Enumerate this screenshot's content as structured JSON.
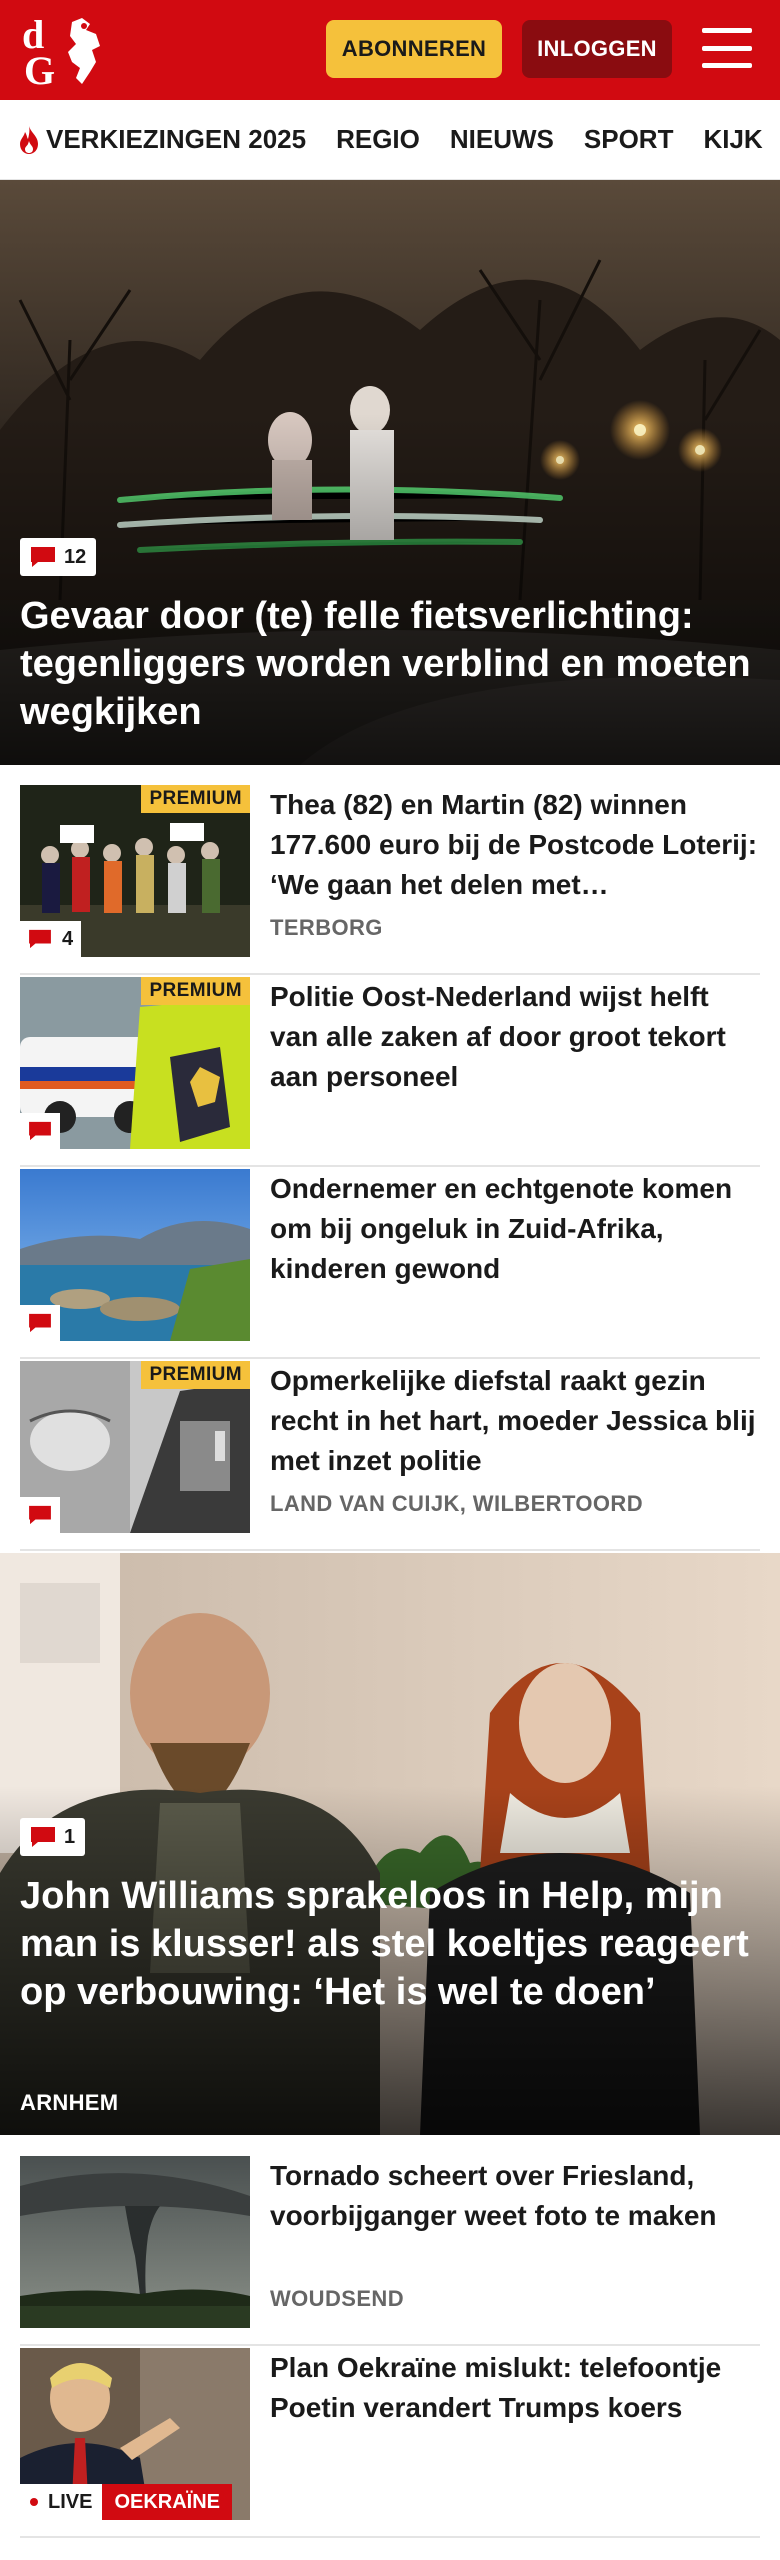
{
  "header": {
    "logo_alt": "dG",
    "subscribe_label": "ABONNEREN",
    "login_label": "INLOGGEN"
  },
  "nav": {
    "items": [
      {
        "label": "VERKIEZINGEN 2025",
        "icon": "flame-icon"
      },
      {
        "label": "REGIO"
      },
      {
        "label": "NIEUWS"
      },
      {
        "label": "SPORT"
      },
      {
        "label": "KIJK"
      }
    ]
  },
  "colors": {
    "brand_red": "#d10a11",
    "premium_yellow": "#f5c13b",
    "login_dark_red": "#8a0c10"
  },
  "hero": {
    "comments": "12",
    "title": "Gevaar door (te) felle fietsverlichting: tegenliggers worden verblind en moeten wegkijken"
  },
  "articles": [
    {
      "premium": "PREMIUM",
      "comments": "4",
      "title": "Thea (82) en Martin (82) winnen 177.600 euro bij de Postcode Loterij: ‘We gaan het delen met…",
      "location": "TERBORG"
    },
    {
      "premium": "PREMIUM",
      "title": "Politie Oost-Nederland wijst helft van alle zaken af door groot tekort aan personeel"
    },
    {
      "title": "Ondernemer en echtgenote komen om bij ongeluk in Zuid-Afrika, kinderen gewond"
    },
    {
      "premium": "PREMIUM",
      "title": "Opmerkelijke diefstal raakt gezin recht in het hart, moeder Jessica blij met inzet politie",
      "location": "LAND VAN CUIJK, WILBERTOORD"
    }
  ],
  "hero2": {
    "comments": "1",
    "title": "John Williams sprakeloos in Help, mijn man is klusser! als stel koeltjes reageert op verbouwing: ‘Het is wel te doen’",
    "location": "ARNHEM"
  },
  "articles2": [
    {
      "title": "Tornado scheert over Friesland, voorbijganger weet foto te maken",
      "location": "WOUDSEND"
    },
    {
      "live_label": "LIVE",
      "tag": "OEKRAÏNE",
      "title": "Plan Oekraïne mislukt: telefoon­tje Poetin verandert Trumps koers"
    }
  ]
}
